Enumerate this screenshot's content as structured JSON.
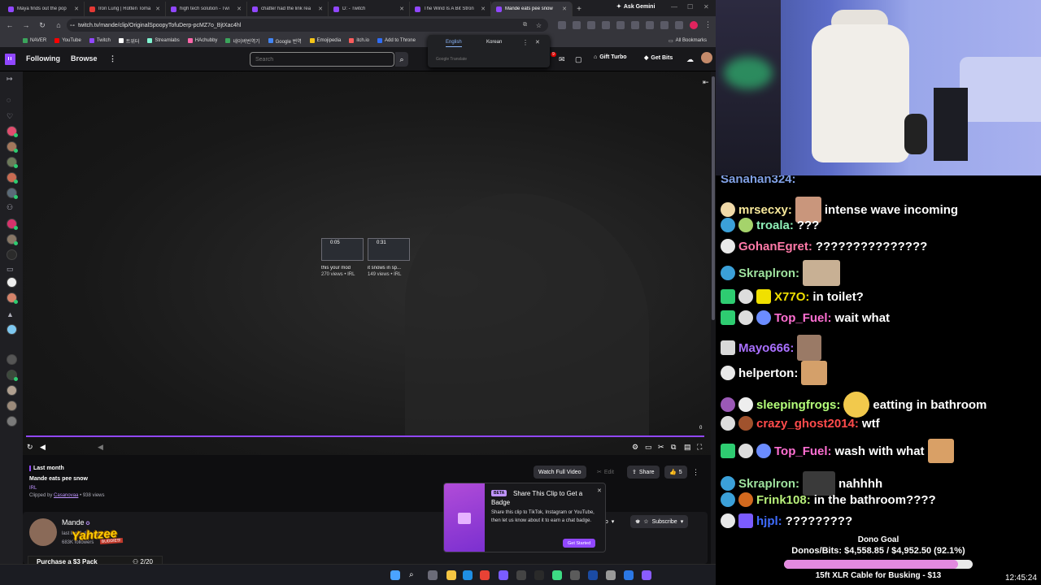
{
  "browser": {
    "tabs": [
      {
        "label": "Maya finds out the pop",
        "active": false
      },
      {
        "label": "Iron Lung | Rotten Toma",
        "active": false
      },
      {
        "label": "high tech solution - Twi",
        "active": false
      },
      {
        "label": "chatter had the link rea",
        "active": false
      },
      {
        "label": "D: - Twitch",
        "active": false
      },
      {
        "label": "The Wind Is A Bit Stron",
        "active": false
      },
      {
        "label": "Mande eats pee snow",
        "active": true
      }
    ],
    "ask_gemini": "Ask Gemini",
    "url": "twitch.tv/mande/clip/OriginalSpoopyTofuDerp-pcMZ7o_BjtXac4hl",
    "bookmarks": [
      "NAVER",
      "YouTube",
      "Twitch",
      "트위터",
      "Streamlabs",
      "HAchubby",
      "네이버번역기",
      "Google 번역",
      "Emojipedia",
      "itch.io",
      "Add to Throne"
    ],
    "all_bookmarks": "All Bookmarks",
    "translate": {
      "lang1": "English",
      "lang2": "Korean",
      "brand": "Google Translate"
    }
  },
  "twitch": {
    "header": {
      "following": "Following",
      "browse": "Browse",
      "search_placeholder": "Search",
      "gift_turbo": "Gift Turbo",
      "get_bits": "Get Bits"
    },
    "related": [
      {
        "duration": "0:05",
        "title": "this your mod",
        "meta": "270 views • IRL"
      },
      {
        "duration": "0:31",
        "title": "it snows in sp...",
        "meta": "149 views • IRL"
      }
    ],
    "video_time": "0",
    "progress": 1.0,
    "clip": {
      "when": "Last month",
      "title": "Mande eats pee snow",
      "category": "IRL",
      "clipped_by_label": "Clipped by",
      "clipper": "Casanovaa",
      "views": "• 938 views"
    },
    "actions": {
      "watch_full": "Watch Full Video",
      "edit": "Edit",
      "share": "Share",
      "likes": "5"
    },
    "channel": {
      "name": "Mande",
      "last_live": "last live 1 day ago",
      "followers": "683K followers",
      "subscribe": "Subscribe",
      "sub_partial": "ub"
    },
    "share_popup": {
      "beta": "BETA",
      "title": "Share This Clip to Get a Badge",
      "desc": "Share this clip to TikTok, Instagram or YouTube, then let us know about it to earn a chat badge.",
      "button": "Get Started"
    }
  },
  "overlay": {
    "yahtzee": "Yahtzee",
    "buddies": "BUDDIES!",
    "purchase_label": "Purchase a $3 Pack",
    "purchase_count": "2/20",
    "purchase_progress": 0.1
  },
  "chat": {
    "cutoff": "Sanahan324:",
    "messages": [
      {
        "user": "mrsecxy:",
        "color": "#f7e89a",
        "text": "intense wave incoming",
        "emote": "before"
      },
      {
        "user": "troala:",
        "color": "#8ff0b8",
        "text": "???",
        "emote": "none"
      },
      {
        "user": "GohanEgret:",
        "color": "#ff7aa8",
        "text": "???????????????",
        "emote": "none"
      },
      {
        "user": "Skraplron:",
        "color": "#9ee29e",
        "text": "",
        "emote": "after"
      },
      {
        "user": "X77O:",
        "color": "#f0e000",
        "text": "in toilet?",
        "emote": "none"
      },
      {
        "user": "Top_Fuel:",
        "color": "#ff6fd2",
        "text": "wait what",
        "emote": "none"
      },
      {
        "user": "Mayo666:",
        "color": "#a970ff",
        "text": "",
        "emote": "after"
      },
      {
        "user": "helperton:",
        "color": "#ffffff",
        "text": "",
        "emote": "after"
      },
      {
        "user": "sleepingfrogs:",
        "color": "#b5ff7a",
        "text": "eatting in bathroom",
        "emote": "after"
      },
      {
        "user": "crazy_ghost2014:",
        "color": "#ff4b4b",
        "text": "wtf",
        "emote": "none"
      },
      {
        "user": "Top_Fuel:",
        "color": "#ff6fd2",
        "text": "wash with what",
        "emote": "trailing"
      },
      {
        "user": "Skraplron:",
        "color": "#9ee29e",
        "text": "nahhhh",
        "emote": "after"
      },
      {
        "user": "Frink108:",
        "color": "#b8f07a",
        "text": "in the bathroom????",
        "emote": "none"
      },
      {
        "user": "hjpl:",
        "color": "#3f6cff",
        "text": "?????????",
        "emote": "none"
      }
    ]
  },
  "dono_goal": {
    "title": "Dono Goal",
    "amount": "Donos/Bits: $4,558.85 / $4,952.50 (92.1%)",
    "progress": 0.921,
    "goal": "15ft XLR Cable for Busking - $13"
  },
  "clock": "12:45:24"
}
